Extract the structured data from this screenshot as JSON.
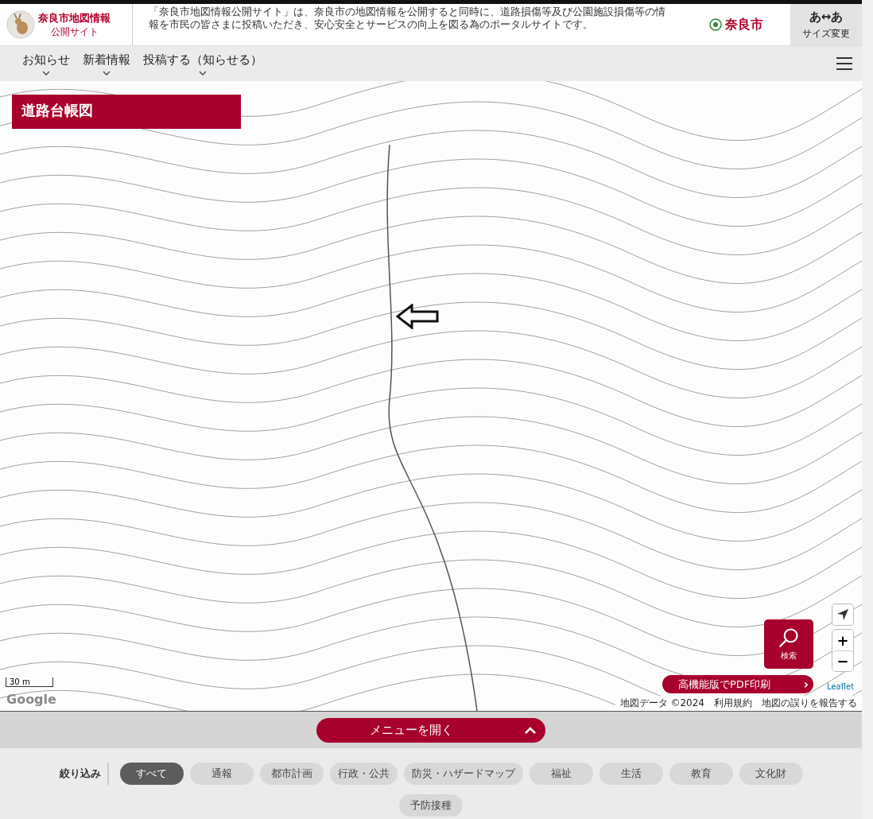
{
  "header": {
    "logo_title": "奈良市地図情報",
    "logo_subtitle": "公開サイト",
    "description": "「奈良市地図情報公開サイト」は、奈良市の地図情報を公開すると同時に、道路損傷等及び公園施設損傷等の情報を市民の皆さまに投稿いただき、安心安全とサービスの向上を図る為のポータルサイトです。",
    "city": "奈良市",
    "font_toggle": "あ↔あ",
    "font_toggle_label": "サイズ変更"
  },
  "nav": {
    "items": [
      {
        "label": "お知らせ"
      },
      {
        "label": "新着情報"
      },
      {
        "label": "投稿する（知らせる）"
      }
    ]
  },
  "map": {
    "layer_title": "道路台帳図",
    "search_button": "検索",
    "zoom_in": "+",
    "zoom_out": "−",
    "pdf_button": "高機能版でPDF印刷",
    "pdf_chevron": "›",
    "scale": "30 m",
    "google": "Google",
    "leaflet": "Leaflet",
    "attribution": [
      "地図データ ©2024",
      "利用規約",
      "地図の誤りを報告する"
    ]
  },
  "menu_bar": {
    "label": "メニューを開く"
  },
  "filter": {
    "label": "絞り込み",
    "chips": [
      {
        "label": "すべて",
        "selected": true
      },
      {
        "label": "通報",
        "selected": false
      },
      {
        "label": "都市計画",
        "selected": false
      },
      {
        "label": "行政・公共",
        "selected": false
      },
      {
        "label": "防災・ハザードマップ",
        "selected": false
      },
      {
        "label": "福祉",
        "selected": false
      },
      {
        "label": "生活",
        "selected": false
      },
      {
        "label": "教育",
        "selected": false
      },
      {
        "label": "文化財",
        "selected": false
      },
      {
        "label": "予防接種",
        "selected": false
      }
    ]
  }
}
